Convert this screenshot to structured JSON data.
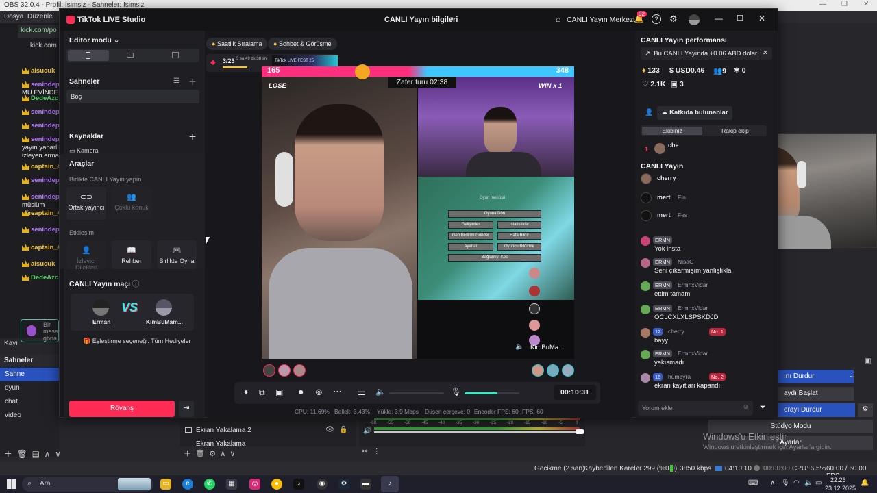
{
  "obs": {
    "title": "OBS 32.0.4 - Profil: İsimsiz - Sahneler: İsimsiz",
    "menu": [
      "Dosya",
      "Düzenle"
    ],
    "browser_tabs": [
      {
        "label": "kick.com/po"
      },
      {
        "label": "kick.com"
      }
    ],
    "chat": [
      {
        "user": "aisucuk",
        "text": "",
        "color": "yellow"
      },
      {
        "user": "senindep",
        "text": "MU EVİNDE",
        "color": "purple"
      },
      {
        "user": "DedeAzc",
        "text": "",
        "color": "green"
      },
      {
        "user": "senindep",
        "text": "",
        "color": "purple"
      },
      {
        "user": "senindep",
        "text": "",
        "color": "purple"
      },
      {
        "user": "senindep",
        "text": "yayın yaparl izleyen erma",
        "color": "purple"
      },
      {
        "user": "captain_4e5",
        "text": "",
        "color": "yellow"
      },
      {
        "user": "senindep",
        "text": "",
        "color": "purple"
      },
      {
        "user": "senindep",
        "text": "müslüm gürs",
        "color": "purple"
      },
      {
        "user": "captain_4e5",
        "text": "",
        "color": "yellow"
      },
      {
        "user": "senindep",
        "text": "",
        "color": "purple"
      },
      {
        "user": "captain_4e5",
        "text": "",
        "color": "yellow"
      },
      {
        "user": "aisucuk",
        "text": "",
        "color": "yellow"
      },
      {
        "user": "DedeAzc",
        "text": "",
        "color": "green"
      }
    ],
    "message_placeholder": "Bir mesa göna",
    "kayit_label": "Kayı",
    "scenes_title": "Sahneler",
    "scenes": [
      "Sahne",
      "oyun",
      "chat",
      "video"
    ],
    "sources": [
      "Ekran Yakalama 2",
      "Ekran Yakalama"
    ],
    "mixer_ticks": [
      "-60",
      "-55",
      "-50",
      "-45",
      "-40",
      "-35",
      "-30",
      "-25",
      "-20",
      "-15",
      "-10",
      "-5",
      "0"
    ],
    "controls": [
      "ını Durdur",
      "aydı Başlat",
      "erayı Durdur",
      "Stüdyo Modu",
      "Ayarlar"
    ],
    "windows_activate": "Windows'u Etkinleştir",
    "windows_activate_sub": "Windows'u etkinleştirmek için Ayarlar'a gidin.",
    "status": {
      "delay": "Gecikme (2 san)",
      "dropped": "Kaybedilen Kareler 299 (%0.0)",
      "kbps": "3850 kbps",
      "live_time": "04:10:10",
      "rec_time": "00:00:00",
      "cpu": "CPU: 6.5%",
      "fps": "60.00 / 60.00 FPS"
    }
  },
  "taskbar": {
    "search": "Ara",
    "time": "22:26",
    "date": "23.12.2025"
  },
  "tiktok": {
    "app_title": "TikTok LIVE Studio",
    "center_title": "CANLI Yayın bilgileri",
    "live_center": "CANLI Yayın Merkezi",
    "notif_count": "92",
    "editor_mode": "Editör modu",
    "scenes_title": "Sahneler",
    "scene_item": "Boş",
    "sources_title": "Kaynaklar",
    "source_item": "Kamera",
    "tools_title": "Araçlar",
    "collab_title": "Birlikte CANLI Yayın yapın",
    "tools_collab": [
      {
        "label": "Ortak yayıncı",
        "enabled": true
      },
      {
        "label": "Çoklu konuk",
        "enabled": false
      }
    ],
    "engage_title": "Etkileşim",
    "tools_engage": [
      {
        "label": "İzleyici Dilekleri",
        "enabled": false
      },
      {
        "label": "Rehber",
        "enabled": true
      },
      {
        "label": "Birlikte Oyna",
        "enabled": true
      }
    ],
    "match_title": "CANLI Yayın maçı",
    "player1": "Erman",
    "player2": "KimBuMam...",
    "vs": "VS",
    "match_option": "Eşleştirme seçeneği: Tüm Hediyeler",
    "rematch": "Rövanş",
    "top_pills": [
      "Saatlik Sıralama",
      "Sohbet & Görüşme"
    ],
    "goal": {
      "progress": "3/23",
      "time": "3 sa 49 dk 38 sn",
      "fest": "TikTok LIVE FEST 25"
    },
    "score_left": "165",
    "score_right": "348",
    "win_round": "Zafer turu 02:38",
    "lose": "LOSE",
    "win": "WIN x 1",
    "game_menu": [
      "Oyun menüsü",
      "Oyuna Dön",
      "Gelişimler",
      "İstatistikler",
      "Geri Bildirim Gönder",
      "Hata Bildir",
      "Ayarlar",
      "Oyuncu Bildirme",
      "Bağlantıyı Kes"
    ],
    "opponent_name": "KimBuMa...",
    "elapsed": "00:10:31",
    "mic_level": 0.6,
    "stats": {
      "cpu": "CPU: 11.69%",
      "mem": "Bellek: 3.43%",
      "upload": "Yükle: 3.9 Mbps",
      "drop": "Düşen çerçeve: 0",
      "enc": "Encoder FPS: 60",
      "fps": "FPS: 60"
    },
    "perf_title": "CANLI Yayın performansı",
    "earn_banner": "Bu CANLI Yayında +0.06 ABD doları",
    "perf": {
      "diamonds": "133",
      "usd": "USD0.46",
      "viewers": "9",
      "new": "0",
      "likes": "2.1K",
      "gifts": "3"
    },
    "contributors": "Katkıda bulunanlar",
    "tabs": [
      "Ekibiniz",
      "Rakip ekip"
    ],
    "contributor_rank": "1",
    "contributor_name": "che",
    "canli_short": "CANLI Yayın",
    "viewers_list": [
      "cherry",
      "mert",
      "mert"
    ],
    "viewers_sub": [
      "",
      "Fin",
      "Fes"
    ],
    "comments": [
      {
        "badge": "ERMN",
        "name": "",
        "text": "Yok insta",
        "level": ""
      },
      {
        "badge": "ERMN",
        "name": "NisaG",
        "text": "Seni çıkarmışım yanlışlıkla",
        "level": ""
      },
      {
        "badge": "ERMN",
        "name": "ErmnxVidar",
        "text": "ettim tamam",
        "level": ""
      },
      {
        "badge": "ERMN",
        "name": "ErmnxVidar",
        "text": "ÖCLCXLXLSPSKDJD",
        "level": ""
      },
      {
        "badge": "12",
        "name": "cherry",
        "text": "bayy",
        "level": "No. 1"
      },
      {
        "badge": "ERMN",
        "name": "ErmnxVidar",
        "text": "yakısmadı",
        "level": ""
      },
      {
        "badge": "16",
        "name": "hümeyra",
        "text": "ekran kayıtları kapandı",
        "level": "No. 2"
      }
    ],
    "comment_placeholder": "Yorum ekle"
  },
  "colors": {
    "accent": "#fe2c55",
    "tiktok_bg": "#18181c",
    "panel": "#1e1e23",
    "obs_blue": "#2a52be"
  }
}
